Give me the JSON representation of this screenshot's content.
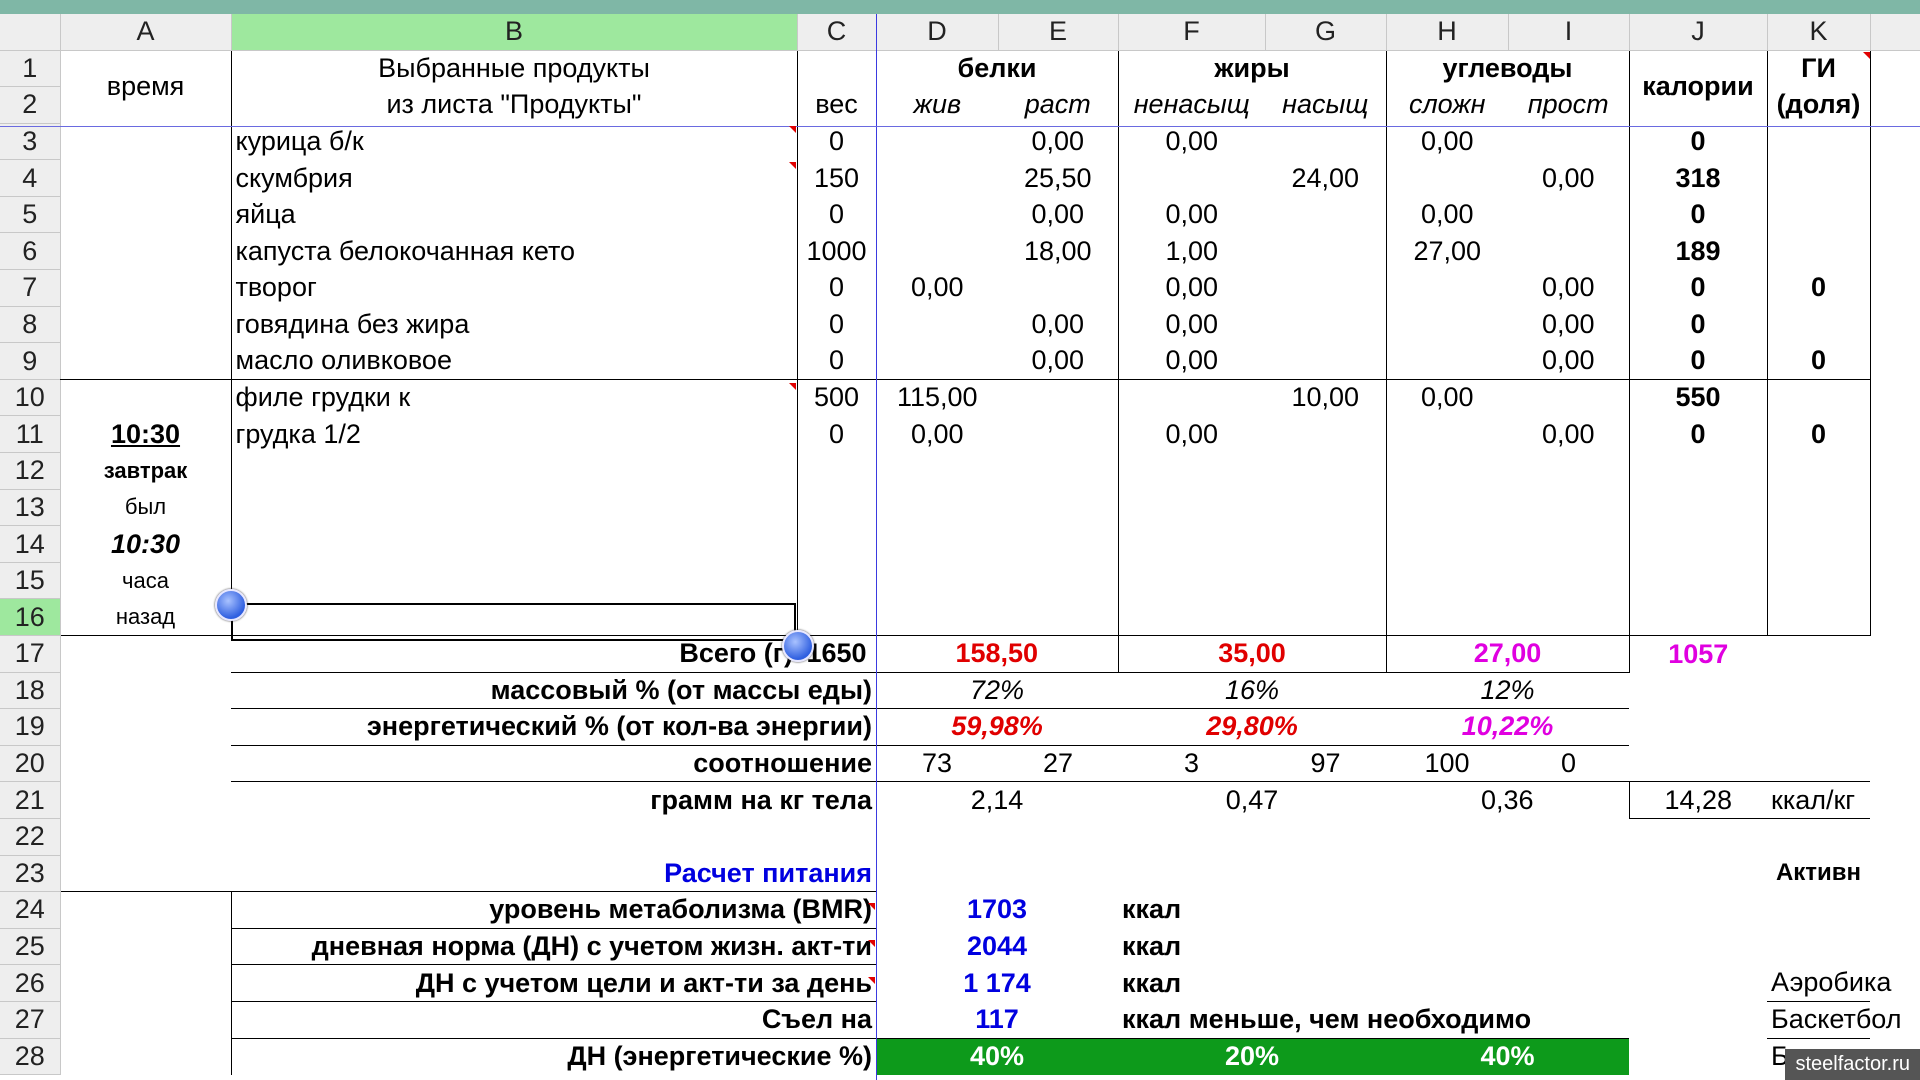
{
  "columns": [
    "A",
    "B",
    "C",
    "D",
    "E",
    "F",
    "G",
    "H",
    "I",
    "J",
    "K"
  ],
  "rows": [
    "1",
    "2",
    "3",
    "4",
    "5",
    "6",
    "7",
    "8",
    "9",
    "10",
    "11",
    "12",
    "13",
    "14",
    "15",
    "16",
    "17",
    "18",
    "19",
    "20",
    "21",
    "22",
    "23",
    "24",
    "25",
    "26",
    "27",
    "28"
  ],
  "header": {
    "time": "время",
    "products_line1": "Выбранные продукты",
    "products_line2": "из листа \"Продукты\"",
    "weight": "вес",
    "proteins": "белки",
    "fats": "жиры",
    "carbs": "углеводы",
    "calories": "калории",
    "gi_line1": "ГИ",
    "gi_line2": "(доля)",
    "prot_animal": "жив",
    "prot_plant": "раст",
    "fat_unsat": "ненасыщ",
    "fat_sat": "насыщ",
    "carb_complex": "сложн",
    "carb_simple": "прост"
  },
  "products": [
    {
      "name": "курица б/к",
      "weight": "0",
      "d": "",
      "e": "0,00",
      "f": "0,00",
      "g": "",
      "h": "0,00",
      "i": "",
      "j": "0",
      "k": ""
    },
    {
      "name": "скумбрия",
      "weight": "150",
      "d": "",
      "e": "25,50",
      "f": "",
      "g": "24,00",
      "h": "",
      "i": "0,00",
      "j": "318",
      "k": ""
    },
    {
      "name": "яйца",
      "weight": "0",
      "d": "",
      "e": "0,00",
      "f": "0,00",
      "g": "",
      "h": "0,00",
      "i": "",
      "j": "0",
      "k": ""
    },
    {
      "name": "капуста белокочанная кето",
      "weight": "1000",
      "d": "",
      "e": "18,00",
      "f": "1,00",
      "g": "",
      "h": "27,00",
      "i": "",
      "j": "189",
      "k": ""
    },
    {
      "name": "творог",
      "weight": "0",
      "d": "0,00",
      "e": "",
      "f": "0,00",
      "g": "",
      "h": "",
      "i": "0,00",
      "j": "0",
      "k": "0"
    },
    {
      "name": "говядина без жира",
      "weight": "0",
      "d": "",
      "e": "0,00",
      "f": "0,00",
      "g": "",
      "h": "",
      "i": "0,00",
      "j": "0",
      "k": ""
    },
    {
      "name": "масло оливковое",
      "weight": "0",
      "d": "",
      "e": "0,00",
      "f": "0,00",
      "g": "",
      "h": "",
      "i": "0,00",
      "j": "0",
      "k": "0"
    },
    {
      "name": "филе грудки к",
      "weight": "500",
      "d": "115,00",
      "e": "",
      "f": "",
      "g": "10,00",
      "h": "0,00",
      "i": "",
      "j": "550",
      "k": ""
    },
    {
      "name": "грудка 1/2",
      "weight": "0",
      "d": "0,00",
      "e": "",
      "f": "0,00",
      "g": "",
      "h": "",
      "i": "0,00",
      "j": "0",
      "k": "0"
    }
  ],
  "meal": {
    "time": "10:30",
    "name": "завтрак",
    "was": "был",
    "ago_time": "10:30",
    "hours": "часа",
    "ago": "назад"
  },
  "totals": {
    "label": "Всего (г)",
    "weight": "1650",
    "proteins": "158,50",
    "fats": "35,00",
    "carbs": "27,00",
    "calories": "1057"
  },
  "mass_pct": {
    "label": "массовый % (от массы еды)",
    "p": "72%",
    "f": "16%",
    "c": "12%"
  },
  "energy_pct": {
    "label": "энергетический % (от кол-ва энергии)",
    "p": "59,98%",
    "f": "29,80%",
    "c": "10,22%"
  },
  "ratio": {
    "label": "соотношение",
    "d": "73",
    "e": "27",
    "f": "3",
    "g": "97",
    "h": "100",
    "i": "0"
  },
  "per_kg": {
    "label": "грамм на кг тела",
    "p": "2,14",
    "f": "0,47",
    "c": "0,36",
    "cal": "14,28",
    "unit": "ккал/кг"
  },
  "nutrition": {
    "title": "Расчет питания",
    "activity": "Активн",
    "bmr_label": "уровень метаболизма (BMR)",
    "bmr": "1703",
    "dn_label": "дневная норма (ДН) с учетом жизн. акт-ти",
    "dn": "2044",
    "dn_goal_label": "ДН с учетом цели и акт-ти за день",
    "dn_goal": "1 174",
    "ate_label": "Съел на",
    "ate": "117",
    "ate_unit": "ккал меньше, чем необходимо",
    "unit": "ккал",
    "dn_energy_label": "ДН (энергетические %)",
    "dn_p": "40%",
    "dn_f": "20%",
    "dn_c": "40%",
    "sports": [
      "Аэробика",
      "Баскетбол",
      "Бе"
    ]
  },
  "watermark": "steelfactor.ru",
  "colors": {
    "selected_header": "#9ee89e",
    "total_red": "#e00000",
    "total_magenta": "#e000e0",
    "blue": "#0000e0",
    "green": "#0d9a1b"
  }
}
